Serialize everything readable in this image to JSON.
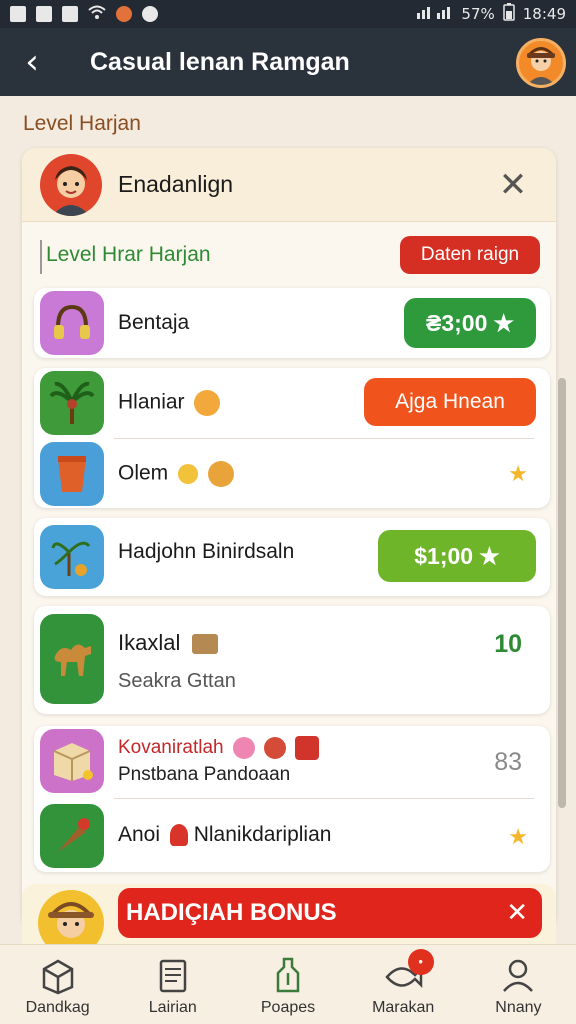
{
  "status_bar": {
    "signal": "57%",
    "time": "18:49"
  },
  "app_bar": {
    "back_glyph": "‹",
    "title": "Casual lenan Ramgan"
  },
  "section_title": "Level Harjan",
  "card": {
    "header_name": "Enadanlign",
    "close_glyph": "✕",
    "subheading": "Level Hrar Harjan",
    "header_pill": "Daten raign"
  },
  "rows": [
    {
      "title": "Bentaja",
      "button": "₴3;00",
      "button_color": "#2e9a3c"
    },
    {
      "title": "Hlaniar",
      "button": "Ajga Hnean",
      "button_color": "#f0541c"
    },
    {
      "title": "Olem"
    },
    {
      "title": "Hadjohn Binirdsaln",
      "button": "$1;00",
      "button_color": "#6fb52a"
    },
    {
      "title": "Ikaxlal",
      "subtitle": "Seakra Gttan",
      "value": "10"
    },
    {
      "title": "Kovaniratlah",
      "subtitle": "Pnstbana Pandoaan",
      "value": "83"
    },
    {
      "title": "Anoi",
      "title2": "Nlanikdariplian"
    }
  ],
  "bonus": {
    "label": "HADIÇIAH BONUS",
    "close_glyph": "✕"
  },
  "bottom_nav": [
    {
      "label": "Dandkag",
      "icon": "box-icon"
    },
    {
      "label": "Lairian",
      "icon": "document-icon"
    },
    {
      "label": "Poapes",
      "icon": "bottle-icon"
    },
    {
      "label": "Marakan",
      "icon": "fish-icon",
      "badge": "•"
    },
    {
      "label": "Nnany",
      "icon": "person-icon"
    }
  ],
  "colors": {
    "appbar": "#2a323c",
    "accent_red": "#d52f24",
    "accent_green": "#2e9a3c"
  }
}
